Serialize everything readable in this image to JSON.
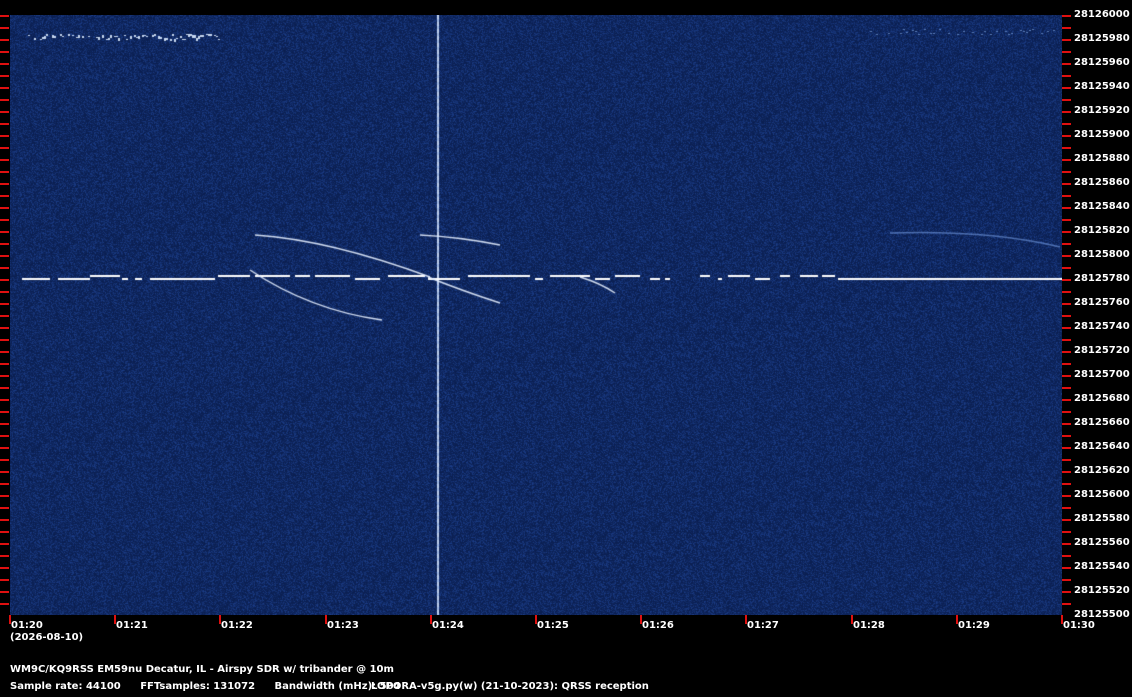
{
  "colors": {
    "background": "#000000",
    "waterfall_bg": "#0d2658",
    "tick": "#e01010",
    "signal": "#ffffff",
    "signal_faint": "#6f9fe0"
  },
  "freq_axis": {
    "labels": [
      "28126000",
      "28125980",
      "28125960",
      "28125940",
      "28125920",
      "28125900",
      "28125880",
      "28125860",
      "28125840",
      "28125820",
      "28125800",
      "28125780",
      "28125760",
      "28125740",
      "28125720",
      "28125700",
      "28125680",
      "28125660",
      "28125640",
      "28125620",
      "28125600",
      "28125580",
      "28125560",
      "28125540",
      "28125520",
      "28125500"
    ]
  },
  "time_axis": {
    "labels": [
      "01:20",
      "01:21",
      "01:22",
      "01:23",
      "01:24",
      "01:25",
      "01:26",
      "01:27",
      "01:28",
      "01:29",
      "01:30"
    ],
    "date": "(2026-08-10)"
  },
  "footer": {
    "station": "WM9C/KQ9RSS EM59nu Decatur, IL - Airspy SDR w/ tribander @ 10m",
    "sample_rate": "Sample rate: 44100",
    "fft_samples": "FFTsamples: 131072",
    "bandwidth": "Bandwidth (mHz): 504",
    "software": "LOPORA-v5g.py(w) (21-10-2023): QRSS reception"
  }
}
